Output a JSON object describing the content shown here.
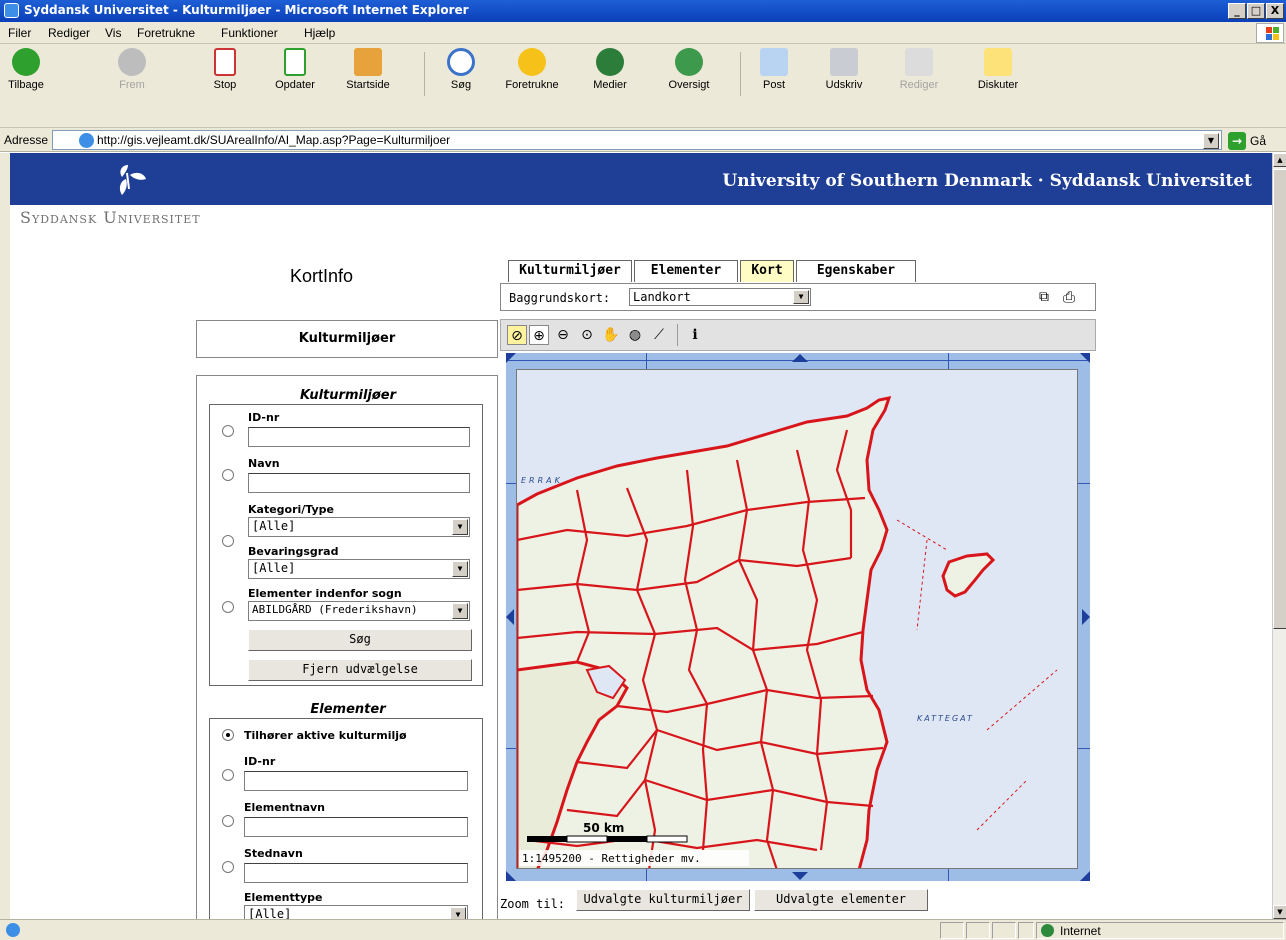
{
  "window": {
    "title": "Syddansk Universitet - Kulturmiljøer - Microsoft Internet Explorer",
    "minimize": "_",
    "maximize": "□",
    "close": "X"
  },
  "menu": [
    "Filer",
    "Rediger",
    "Vis",
    "Foretrukne",
    "Funktioner",
    "Hjælp"
  ],
  "toolbar": {
    "back": "Tilbage",
    "forward": "Frem",
    "stop": "Stop",
    "refresh": "Opdater",
    "home": "Startside",
    "search": "Søg",
    "favorites": "Foretrukne",
    "media": "Medier",
    "history": "Oversigt",
    "mail": "Post",
    "print": "Udskriv",
    "edit": "Rediger",
    "discuss": "Diskuter"
  },
  "address": {
    "label": "Adresse",
    "url": "http://gis.vejleamt.dk/SUArealInfo/AI_Map.asp?Page=Kulturmiljoer",
    "go": "Gå"
  },
  "banner": {
    "heading": "University of Southern Denmark · Syddansk Universitet",
    "wordmark": "Syddansk Universitet"
  },
  "page": {
    "kortinfo": "KortInfo",
    "panel_title": "Kulturmiljøer"
  },
  "kulturmiljoer": {
    "title": "Kulturmiljøer",
    "id_label": "ID-nr",
    "id_value": "",
    "name_label": "Navn",
    "name_value": "",
    "category_label": "Kategori/Type",
    "category_value": "[Alle]",
    "preservation_label": "Bevaringsgrad",
    "preservation_value": "[Alle]",
    "parish_label": "Elementer indenfor sogn",
    "parish_value": "ABILDGÅRD (Frederikshavn)",
    "search_btn": "Søg",
    "clear_btn": "Fjern udvælgelse"
  },
  "elementer": {
    "title": "Elementer",
    "belongs_label": "Tilhører aktive kulturmiljø",
    "id_label": "ID-nr",
    "elementname_label": "Elementnavn",
    "placename_label": "Stednavn",
    "type_label": "Elementtype",
    "type_value": "[Alle]"
  },
  "tabs": [
    "Kulturmiljøer",
    "Elementer",
    "Kort",
    "Egenskaber"
  ],
  "active_tab": "Kort",
  "basemap": {
    "label": "Baggrundskort:",
    "value": "Landkort"
  },
  "map": {
    "scale_label": "50 km",
    "scale_text": "1:1495200 - Rettigheder mv.",
    "sea_labels": [
      "ERRAK",
      "KATTEGAT"
    ]
  },
  "zoom": {
    "label": "Zoom til:",
    "btn_culture": "Udvalgte kulturmiljøer",
    "btn_elements": "Udvalgte elementer"
  },
  "status": {
    "zone": "Internet"
  },
  "colors": {
    "banner": "#1f3e96",
    "active_tab": "#fffcc4",
    "boundary": "#e8161b",
    "sea": "#dfe7f5"
  }
}
